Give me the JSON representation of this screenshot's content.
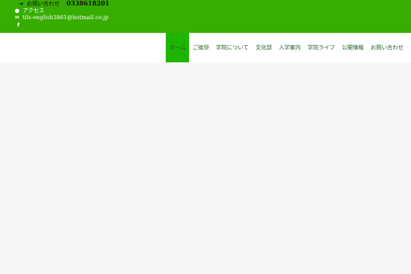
{
  "topbar": {
    "contact_label": "お問い合わせ",
    "phone": "0338618201",
    "access_label": "アクセス",
    "email": "tils-english3861@hotmail.co.jp",
    "facebook_label": "f",
    "colors": {
      "background": "#36ad00",
      "active_nav": "#1fb400"
    },
    "icons": {
      "contact": "arrow-right-icon",
      "access": "map-pin-icon",
      "email": "envelope-icon",
      "facebook": "facebook-icon"
    }
  },
  "nav": {
    "items": [
      {
        "label": "ホーム",
        "active": true
      },
      {
        "label": "ご挨拶"
      },
      {
        "label": "学院について"
      },
      {
        "label": "文化部"
      },
      {
        "label": "入学案内"
      },
      {
        "label": "学院ライフ"
      },
      {
        "label": "公開情報"
      },
      {
        "label": "お問い合わせ"
      }
    ]
  }
}
